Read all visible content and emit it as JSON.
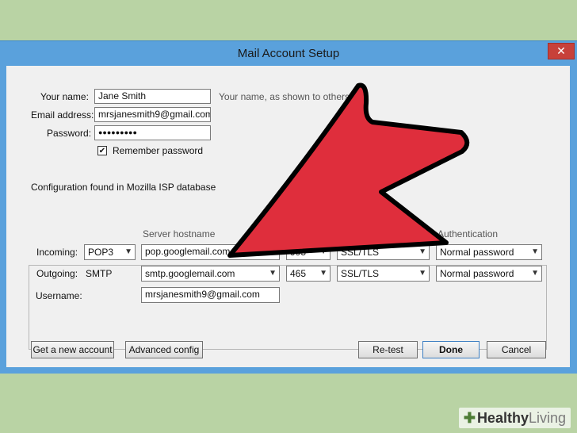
{
  "window": {
    "title": "Mail Account Setup",
    "close_glyph": "✕"
  },
  "form": {
    "name_label": "Your name:",
    "name_value": "Jane Smith",
    "name_hint": "Your name, as shown to others",
    "email_label": "Email address:",
    "email_value": "mrsjanesmith9@gmail.com",
    "password_label": "Password:",
    "password_value": "●●●●●●●●●",
    "remember_label": "Remember password",
    "remember_checked": true,
    "config_status": "Configuration found in Mozilla ISP database"
  },
  "servers": {
    "hostname_header": "Server hostname",
    "auth_header": "Authentication",
    "incoming_label": "Incoming:",
    "incoming_protocol": "POP3",
    "incoming_host": "pop.googlemail.com",
    "incoming_port": "995",
    "incoming_ssl": "SSL/TLS",
    "incoming_auth": "Normal password",
    "outgoing_label": "Outgoing:",
    "outgoing_protocol": "SMTP",
    "outgoing_host": "smtp.googlemail.com",
    "outgoing_port": "465",
    "outgoing_ssl": "SSL/TLS",
    "outgoing_auth": "Normal password",
    "username_label": "Username:",
    "username_value": "mrsjanesmith9@gmail.com"
  },
  "buttons": {
    "get_account": "Get a new account",
    "advanced": "Advanced config",
    "retest": "Re-test",
    "done": "Done",
    "cancel": "Cancel"
  },
  "watermark": {
    "name_bold": "Healthy",
    "name_light": "Living"
  },
  "colors": {
    "arrow": "#df2e3c",
    "titlebar": "#5aa1dc",
    "background": "#b9d3a4"
  }
}
